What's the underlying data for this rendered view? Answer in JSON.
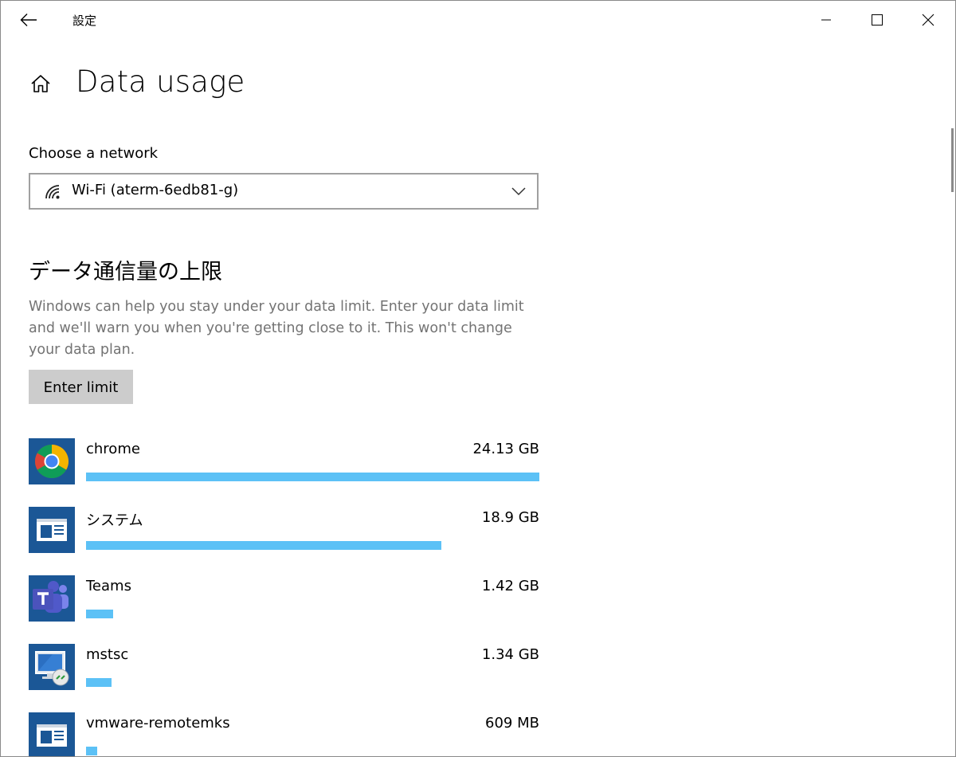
{
  "window": {
    "app_title": "設定"
  },
  "header": {
    "title": "Data usage"
  },
  "network": {
    "label": "Choose a network",
    "selected": "Wi-Fi (aterm-6edb81-g)",
    "icon": "wifi-icon"
  },
  "limit": {
    "title": "データ通信量の上限",
    "description": "Windows can help you stay under your data limit. Enter your data limit and we'll warn you when you're getting close to it. This won't change your data plan.",
    "button_label": "Enter limit"
  },
  "apps": [
    {
      "name": "chrome",
      "size": "24.13 GB",
      "fraction": 1.0,
      "icon": "chrome-icon"
    },
    {
      "name": "システム",
      "size": "18.9 GB",
      "fraction": 0.783,
      "icon": "system-window-icon"
    },
    {
      "name": "Teams",
      "size": "1.42 GB",
      "fraction": 0.059,
      "icon": "teams-icon"
    },
    {
      "name": "mstsc",
      "size": "1.34 GB",
      "fraction": 0.056,
      "icon": "remote-desktop-icon"
    },
    {
      "name": "vmware-remotemks",
      "size": "609 MB",
      "fraction": 0.025,
      "icon": "vmware-window-icon"
    }
  ],
  "colors": {
    "bar": "#5cc1f6",
    "icon_bg": "#1b5796",
    "button_bg": "#cccccc",
    "description_text": "#737373"
  }
}
